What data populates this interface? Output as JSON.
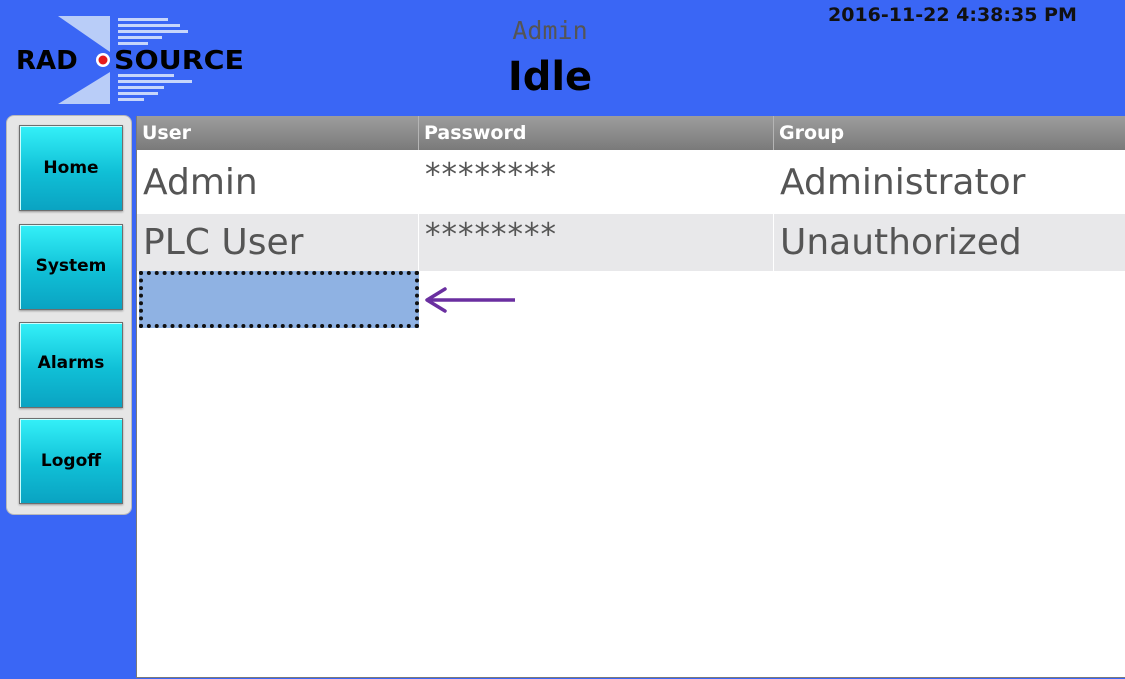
{
  "header": {
    "logo_left": "RAD",
    "logo_right": "SOURCE",
    "current_user": "Admin",
    "status": "Idle",
    "datetime": "2016-11-22 4:38:35 PM"
  },
  "nav": [
    {
      "label": "Home"
    },
    {
      "label": "System"
    },
    {
      "label": "Alarms"
    },
    {
      "label": "Logoff"
    }
  ],
  "table": {
    "columns": [
      "User",
      "Password",
      "Group"
    ],
    "rows": [
      {
        "user": "Admin",
        "password": "********",
        "group": "Administrator"
      },
      {
        "user": "PLC User",
        "password": "********",
        "group": "Unauthorized"
      }
    ],
    "new_row_value": ""
  },
  "colors": {
    "background": "#3a66f5",
    "nav_button": "#1ed6e6",
    "selected_row": "#8fb2e3",
    "arrow": "#6a2fa0"
  },
  "icons": {
    "logo": "rad-source-logo",
    "arrow": "arrow-left-icon"
  }
}
